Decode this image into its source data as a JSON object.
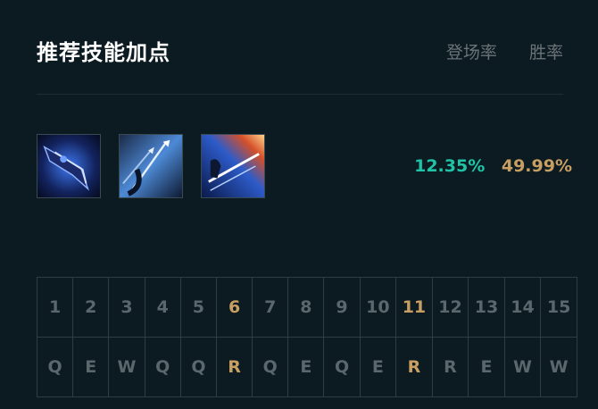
{
  "header": {
    "title": "推荐技能加点",
    "pick_rate_label": "登场率",
    "win_rate_label": "胜率"
  },
  "skills": [
    {
      "icon": "skill-q-icon",
      "color": "#2a5bd7"
    },
    {
      "icon": "skill-w-icon",
      "color": "#5aa0e8"
    },
    {
      "icon": "skill-e-icon",
      "color": "#d94a2a"
    }
  ],
  "stats": {
    "pick_rate": "12.35%",
    "win_rate": "49.99%"
  },
  "levels": [
    {
      "level": "1",
      "skill": "Q",
      "highlight": false
    },
    {
      "level": "2",
      "skill": "E",
      "highlight": false
    },
    {
      "level": "3",
      "skill": "W",
      "highlight": false
    },
    {
      "level": "4",
      "skill": "Q",
      "highlight": false
    },
    {
      "level": "5",
      "skill": "Q",
      "highlight": false
    },
    {
      "level": "6",
      "skill": "R",
      "highlight": true
    },
    {
      "level": "7",
      "skill": "Q",
      "highlight": false
    },
    {
      "level": "8",
      "skill": "E",
      "highlight": false
    },
    {
      "level": "9",
      "skill": "Q",
      "highlight": false
    },
    {
      "level": "10",
      "skill": "E",
      "highlight": false
    },
    {
      "level": "11",
      "skill": "R",
      "highlight": true
    },
    {
      "level": "12",
      "skill": "R",
      "highlight": false
    },
    {
      "level": "13",
      "skill": "E",
      "highlight": false
    },
    {
      "level": "14",
      "skill": "W",
      "highlight": false
    },
    {
      "level": "15",
      "skill": "W",
      "highlight": false
    }
  ],
  "colors": {
    "background": "#0c1a21",
    "pick_rate": "#1fc4a7",
    "win_rate": "#c89f62",
    "highlight": "#c89f62",
    "muted": "#5a676d"
  }
}
